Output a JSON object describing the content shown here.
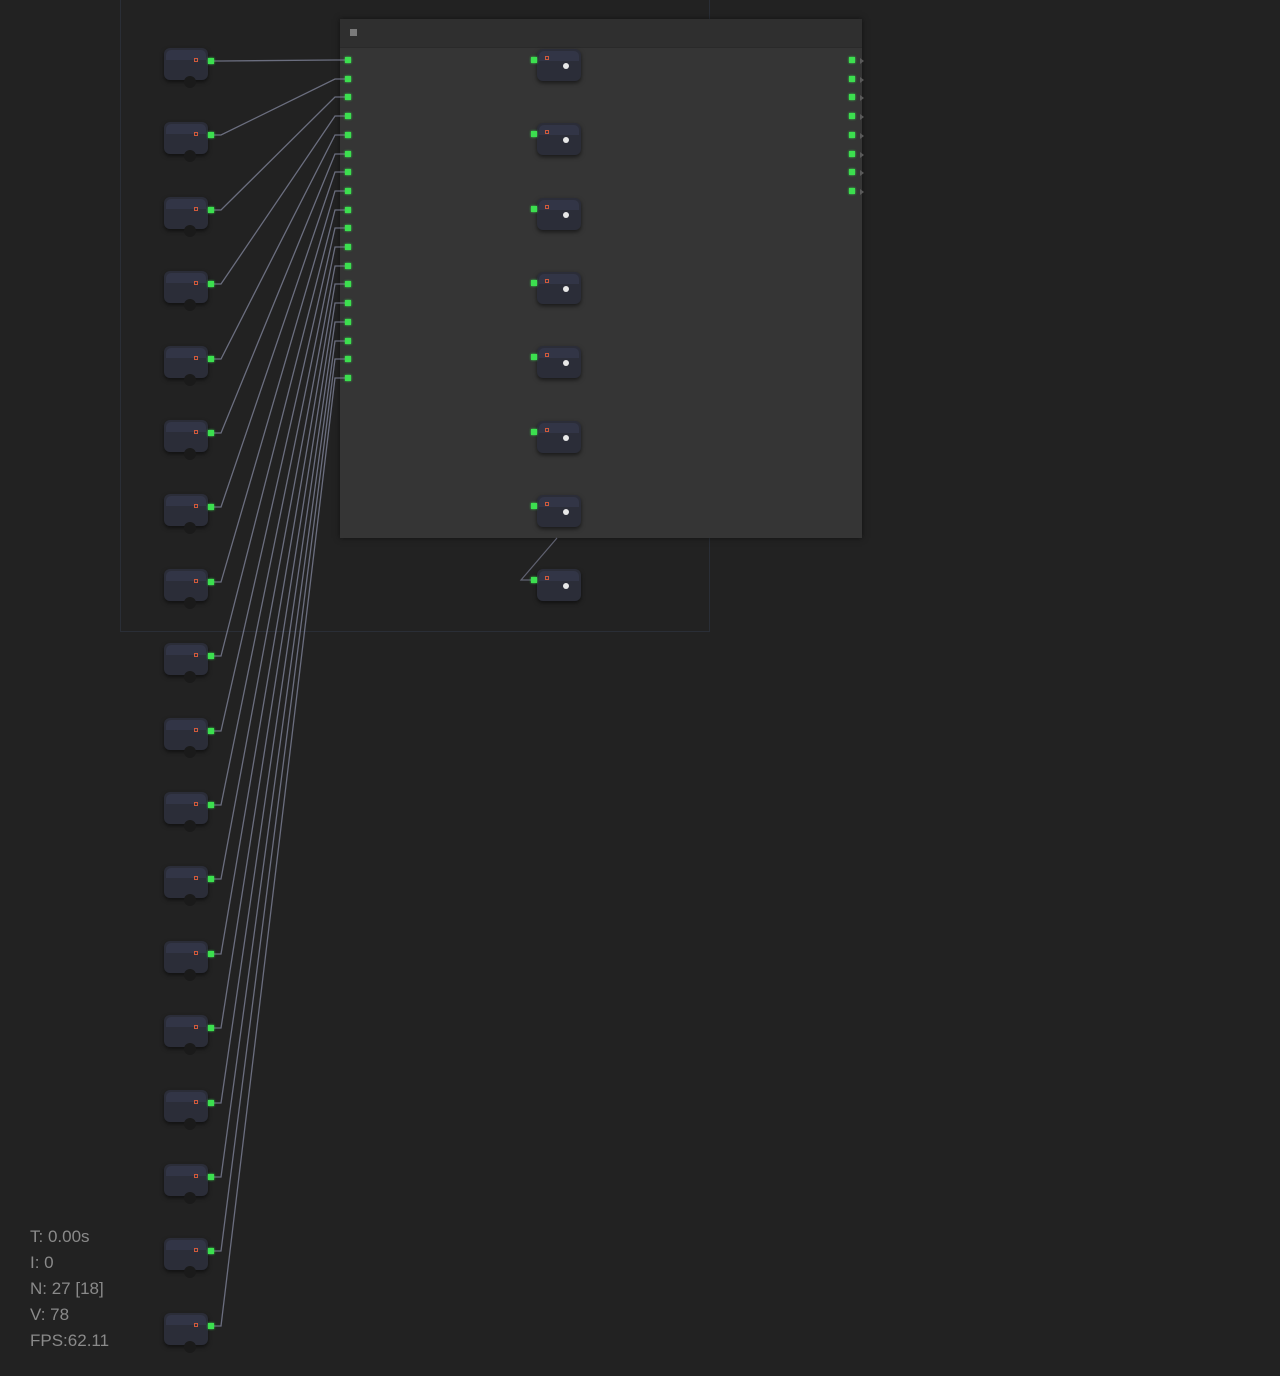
{
  "stats": {
    "time": "T: 0.00s",
    "iteration": "I: 0",
    "nodes": "N: 27 [18]",
    "vertices": "V: 78",
    "fps": "FPS:62.11"
  },
  "graph": {
    "left_nodes_count": 18,
    "inner_nodes_count": 8,
    "group_input_slots": 18,
    "group_output_slots": 8
  },
  "colors": {
    "background": "#222222",
    "node_body": "#353535",
    "slot": "#3cdf4f",
    "link": "#8a8ea6",
    "accent": "#d05a3c"
  }
}
